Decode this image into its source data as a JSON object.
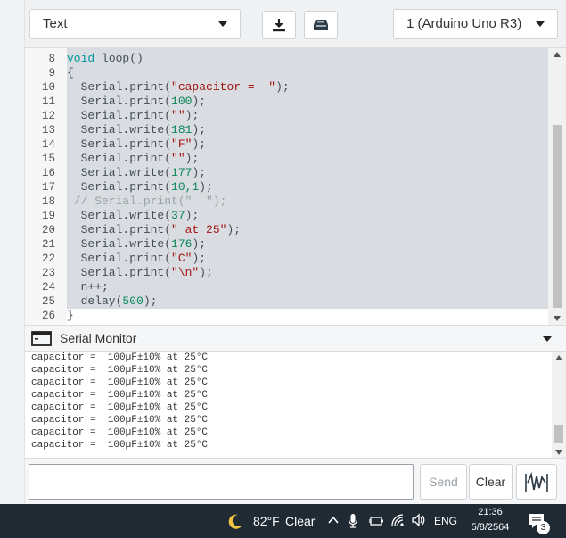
{
  "toolbar": {
    "mode_dropdown": "Text",
    "board_dropdown": "1 (Arduino Uno R3)",
    "download_icon": "download-icon",
    "upload_icon": "device-upload-icon"
  },
  "code": {
    "lines": [
      {
        "n": "8"
      },
      {
        "n": "9"
      },
      {
        "n": "10"
      },
      {
        "n": "11"
      },
      {
        "n": "12"
      },
      {
        "n": "13"
      },
      {
        "n": "14"
      },
      {
        "n": "15"
      },
      {
        "n": "16"
      },
      {
        "n": "17"
      },
      {
        "n": "18"
      },
      {
        "n": "19"
      },
      {
        "n": "20"
      },
      {
        "n": "21"
      },
      {
        "n": "22"
      },
      {
        "n": "23"
      },
      {
        "n": "24"
      },
      {
        "n": "25"
      },
      {
        "n": "26"
      }
    ],
    "tokens": {
      "l8": [
        "void",
        " loop()"
      ],
      "l9": [
        "{"
      ],
      "l10": [
        "  Serial.print(",
        "\"capacitor =  \"",
        ");"
      ],
      "l11": [
        "  Serial.print(",
        "100",
        ");"
      ],
      "l12": [
        "  Serial.print(",
        "\"\"",
        ");"
      ],
      "l13": [
        "  Serial.write(",
        "181",
        ");"
      ],
      "l14": [
        "  Serial.print(",
        "\"F\"",
        ");"
      ],
      "l15": [
        "  Serial.print(",
        "\"\"",
        ");"
      ],
      "l16": [
        "  Serial.write(",
        "177",
        ");"
      ],
      "l17": [
        "  Serial.print(",
        "10,1",
        ");"
      ],
      "l18": [
        " // Serial.print(\"  \");"
      ],
      "l19": [
        "  Serial.write(",
        "37",
        ");"
      ],
      "l20": [
        "  Serial.print(",
        "\" at 25\"",
        ");"
      ],
      "l21": [
        "  Serial.write(",
        "176",
        ");"
      ],
      "l22": [
        "  Serial.print(",
        "\"C\"",
        ");"
      ],
      "l23": [
        "  Serial.print(",
        "\"\\n\"",
        ");"
      ],
      "l24": [
        "  n++;"
      ],
      "l25": [
        "  delay(",
        "500",
        ");"
      ],
      "l26": [
        "}"
      ]
    }
  },
  "serial_monitor": {
    "title": "Serial Monitor",
    "output_lines": [
      "capacitor =  100µF±10% at 25°C",
      "capacitor =  100µF±10% at 25°C",
      "capacitor =  100µF±10% at 25°C",
      "capacitor =  100µF±10% at 25°C",
      "capacitor =  100µF±10% at 25°C",
      "capacitor =  100µF±10% at 25°C",
      "capacitor =  100µF±10% at 25°C",
      "capacitor =  100µF±10% at 25°C"
    ],
    "input_value": "",
    "send_label": "Send",
    "clear_label": "Clear",
    "graph_icon": "waveform-icon"
  },
  "taskbar": {
    "weather_temp": "82°F",
    "weather_desc": "Clear",
    "language": "ENG",
    "time": "21:36",
    "date": "5/8/2564",
    "notification_count": "3"
  }
}
